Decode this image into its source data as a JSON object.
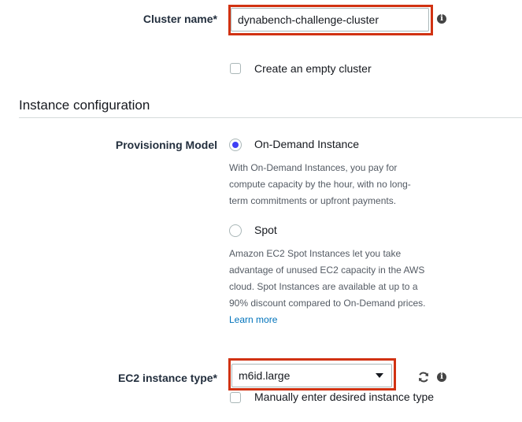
{
  "cluster": {
    "label": "Cluster name*",
    "value": "dynabench-challenge-cluster",
    "empty_cluster_label": "Create an empty cluster"
  },
  "instance_config": {
    "heading": "Instance configuration",
    "provisioning_label": "Provisioning Model",
    "on_demand": {
      "label": "On-Demand Instance",
      "selected": true,
      "description_lines": [
        "With On-Demand Instances, you pay for",
        "compute capacity by the hour, with no long-",
        "term commitments or upfront payments."
      ]
    },
    "spot": {
      "label": "Spot",
      "selected": false,
      "description_lines": [
        "Amazon EC2 Spot Instances let you take",
        "advantage of unused EC2 capacity in the AWS",
        "cloud. Spot Instances are available at up to a",
        "90% discount compared to On-Demand prices."
      ],
      "learn_more": "Learn more"
    },
    "ec2_label": "EC2 instance type*",
    "ec2_value": "m6id.large",
    "manual_entry_label": "Manually enter desired instance type"
  },
  "colors": {
    "highlight": "#d13212",
    "radio_selected": "#3f3ff5",
    "link": "#0073bb"
  },
  "icons": [
    "info-icon",
    "refresh-icon",
    "caret-down-icon"
  ]
}
